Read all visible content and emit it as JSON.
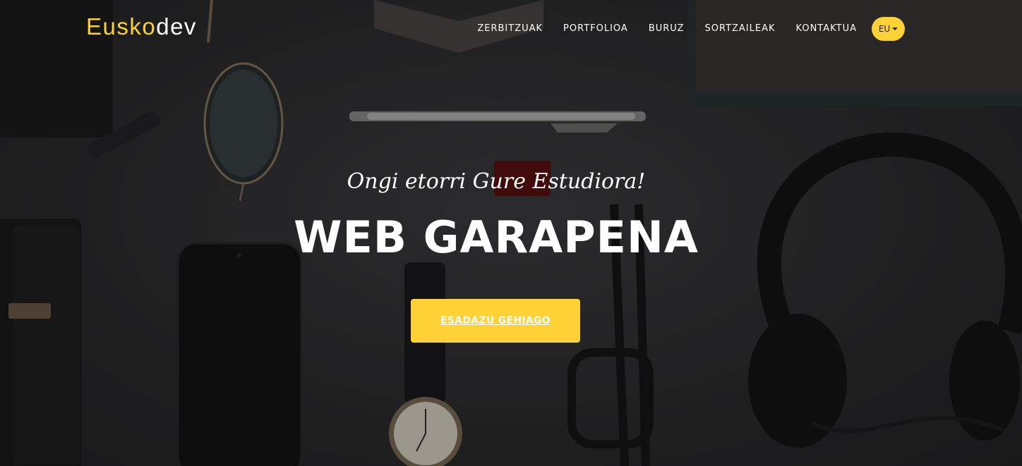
{
  "brand": {
    "first": "Eusko",
    "second": "dev"
  },
  "nav": {
    "items": [
      {
        "label": "ZERBITZUAK"
      },
      {
        "label": "PORTFOLIOA"
      },
      {
        "label": "BURUZ"
      },
      {
        "label": "SORTZAILEAK"
      },
      {
        "label": "KONTAKTUA"
      }
    ],
    "language": "EU"
  },
  "hero": {
    "lead": "Ongi etorri Gure Estudiora!",
    "heading": "WEB GARAPENA",
    "button": "ESADAZU GEHIAGO"
  },
  "colors": {
    "accent": "#fed136",
    "background": "#2e2e30"
  }
}
